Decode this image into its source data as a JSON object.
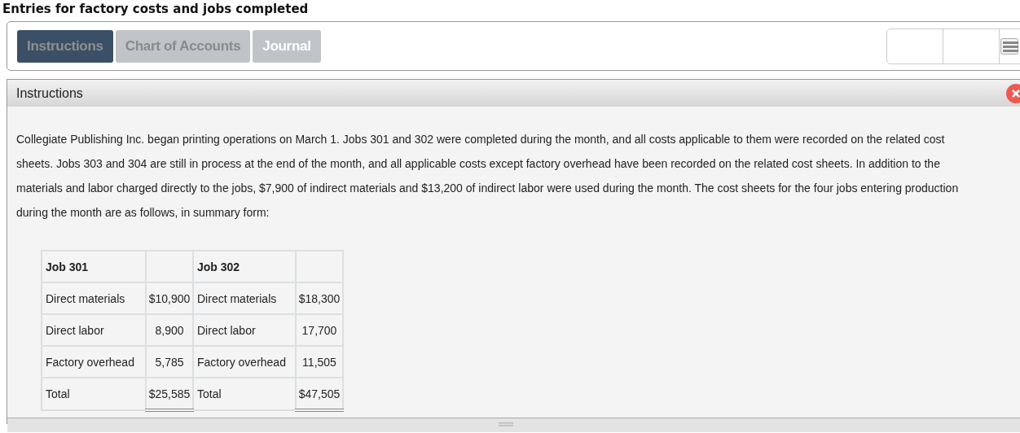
{
  "title": "Entries for factory costs and jobs completed",
  "tabs": [
    {
      "label": "Instructions",
      "selected": true,
      "bright_label": false
    },
    {
      "label": "Chart of Accounts",
      "selected": false,
      "bright_label": false
    },
    {
      "label": "Journal",
      "selected": false,
      "bright_label": true
    }
  ],
  "panel": {
    "title": "Instructions",
    "paragraph": "Collegiate Publishing Inc. began printing operations on March 1. Jobs 301 and 302 were completed during the month, and all costs applicable to them were recorded on the related cost sheets. Jobs 303 and 304 are still in process at the end of the month, and all applicable costs except factory overhead have been recorded on the related cost sheets. In addition to the materials and labor charged directly to the jobs, $7,900 of indirect materials and $13,200 of indirect labor were used during the month. The cost sheets for the four jobs entering production during the month are as follows, in summary form:",
    "table": {
      "rows": [
        {
          "kind": "header",
          "cells": [
            "Job 301",
            "",
            "Job 302",
            ""
          ]
        },
        {
          "kind": "body",
          "cells": [
            "Direct materials",
            "$10,900",
            "Direct materials",
            "$18,300"
          ]
        },
        {
          "kind": "body",
          "cells": [
            "Direct labor",
            "8,900",
            "Direct labor",
            "17,700"
          ]
        },
        {
          "kind": "body",
          "cells": [
            "Factory overhead",
            "5,785",
            "Factory overhead",
            "11,505"
          ]
        },
        {
          "kind": "total",
          "cells": [
            "Total",
            "$25,585",
            "Total",
            "$47,505"
          ]
        }
      ]
    }
  }
}
